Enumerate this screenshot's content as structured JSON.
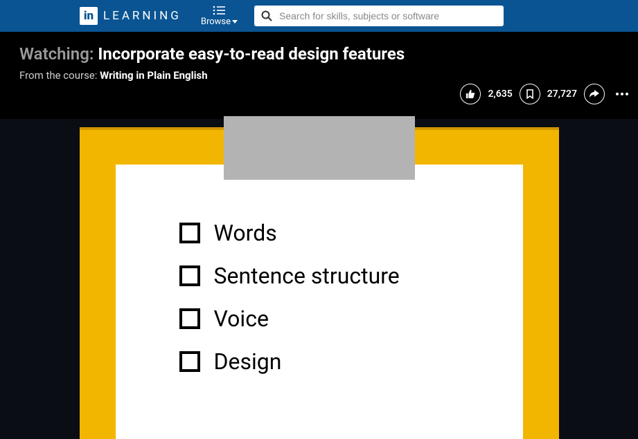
{
  "nav": {
    "logo_text": "in",
    "learning_label": "LEARNING",
    "browse_label": "Browse",
    "search_placeholder": "Search for skills, subjects or software"
  },
  "header": {
    "watching_prefix": "Watching:",
    "video_title": "Incorporate easy-to-read design features",
    "course_prefix": "From the course:",
    "course_name": "Writing in Plain English"
  },
  "actions": {
    "like_count": "2,635",
    "bookmark_count": "27,727"
  },
  "slide": {
    "items": [
      "Words",
      "Sentence structure",
      "Voice",
      "Design"
    ]
  }
}
